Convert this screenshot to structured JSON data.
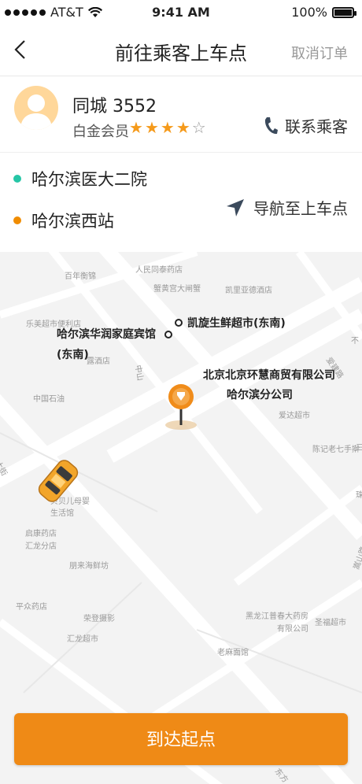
{
  "status_bar": {
    "carrier": "AT&T",
    "time": "9:41 AM",
    "battery": "100%"
  },
  "header": {
    "title": "前往乘客上车点",
    "cancel_label": "取消订单"
  },
  "passenger": {
    "name": "同城 3552",
    "level": "白金会员",
    "rating": 4,
    "rating_max": 5,
    "contact_label": "联系乘客"
  },
  "route": {
    "start": {
      "name": "哈尔滨医大二院",
      "color": "#26c6a6"
    },
    "end": {
      "name": "哈尔滨西站",
      "color": "#f08c00"
    },
    "navigate_label": "导航至上车点"
  },
  "map": {
    "pois": [
      "百年衡锦",
      "人民同泰药店",
      "蟹黄宫大闸蟹",
      "凯里亚德酒店",
      "乐美超市便利店",
      "露酒店",
      "中国石油",
      "爱达超市",
      "陈记老七手擀",
      "贝贝儿母婴",
      "生活馆",
      "启康药店",
      "汇龙分店",
      "朋来海鲜坊",
      "平众药店",
      "荣登摄影",
      "汇龙超市",
      "黑龙江普春大药房",
      "有限公司",
      "老麻面馆",
      "圣福超市",
      "爱建路",
      "嵩山路",
      "不",
      "中山",
      "珠",
      "三",
      "大街",
      "东方"
    ],
    "labels": {
      "supermarket": "凯旋生鲜超市(东南)",
      "hotel_line1": "哈尔滨华润家庭宾馆",
      "hotel_line2": "(东南)",
      "company_line1": "北京北京环慧商贸有限公司",
      "company_line2": "哈尔滨分公司"
    }
  },
  "action": {
    "arrive_label": "到达起点"
  },
  "colors": {
    "accent": "#ef8a16",
    "star": "#f59a1b"
  }
}
